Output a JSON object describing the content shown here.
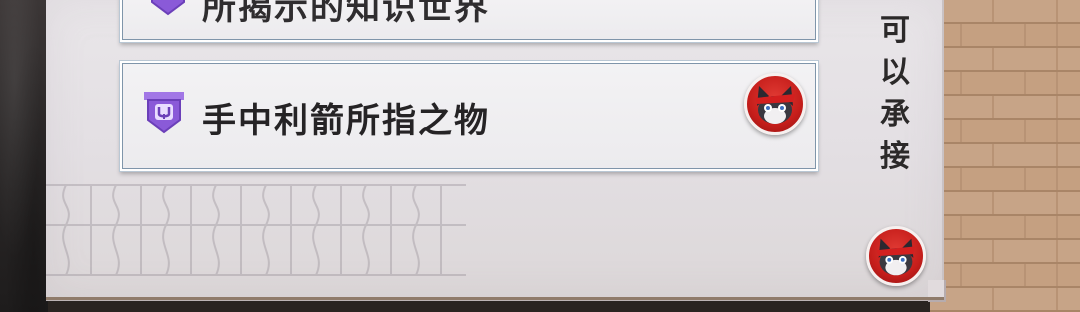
{
  "option_top": {
    "label": "所揭示的知识世界"
  },
  "option_main": {
    "label": "手中利箭所指之物"
  },
  "side_text": [
    "可",
    "以",
    "承",
    "接"
  ],
  "colors": {
    "badge_purple": "#8a5ad8",
    "avatar_red": "#cf2520",
    "panel_bg": "#e6e2e5"
  }
}
